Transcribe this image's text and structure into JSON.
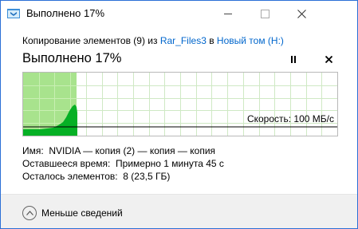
{
  "window": {
    "title": "Выполнено 17%",
    "icon": "copy-progress-icon"
  },
  "copy": {
    "prefix": "Копирование элементов (9) из ",
    "source": "Rar_Files3",
    "middle": " в ",
    "destination": "Новый том (H:)"
  },
  "status": {
    "text": "Выполнено 17%",
    "percent_complete": 17
  },
  "graph": {
    "speed_label": "Скорость: 100 МБ/с",
    "progress_fraction": 0.17
  },
  "details": {
    "name_label": "Имя:",
    "name_value": "NVIDIA — копия (2) — копия — копия",
    "time_label": "Оставшееся время:",
    "time_value": "Примерно 1 минута 45 с",
    "items_label": "Осталось элементов:",
    "items_value": "8 (23,5 ГБ)"
  },
  "footer": {
    "less_details_label": "Меньше сведений"
  },
  "colors": {
    "progress_fill": "#a8e38d",
    "speed_fill": "#06b025",
    "accent_link": "#0066cc",
    "window_border": "#2b6fd6"
  }
}
